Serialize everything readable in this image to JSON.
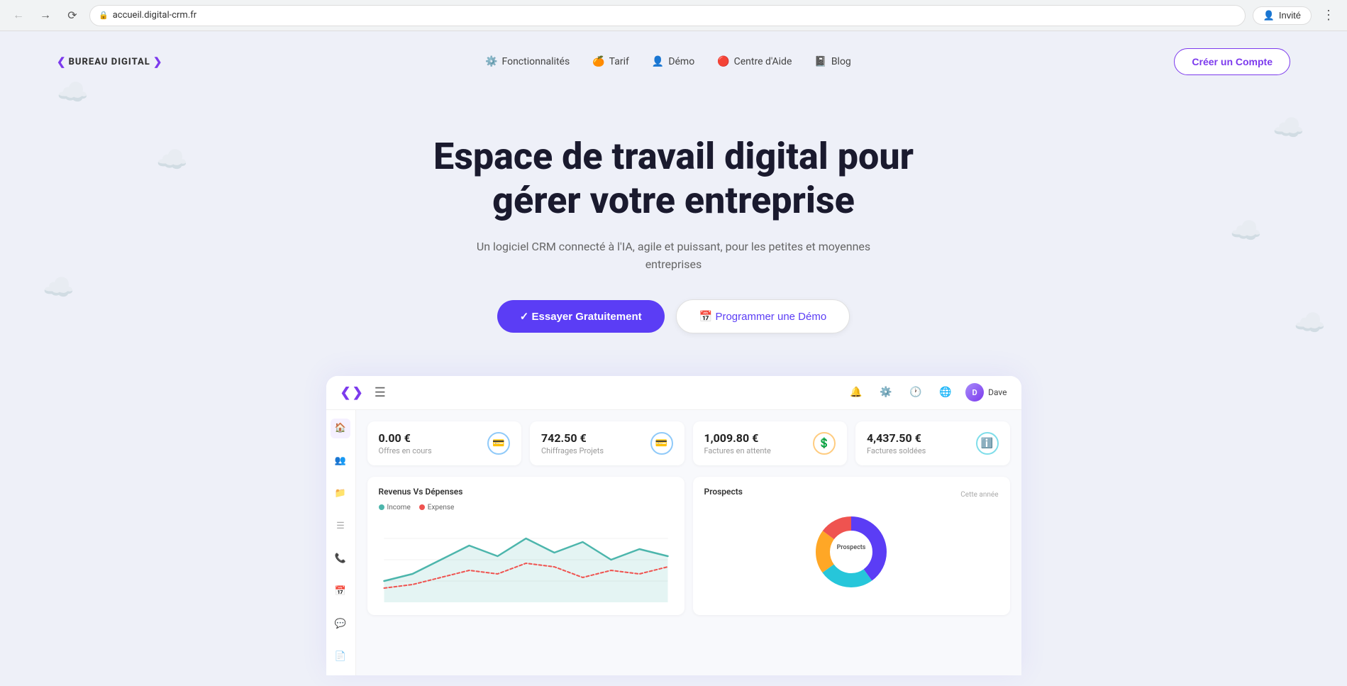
{
  "browser": {
    "url": "accueil.digital-crm.fr",
    "back_disabled": false,
    "forward_disabled": false,
    "invite_label": "Invité",
    "lock_icon": "🔒"
  },
  "nav": {
    "logo_left_chevron": "❮",
    "logo_text": "BUREAU DIGITAL",
    "logo_right_chevron": "❯",
    "links": [
      {
        "icon": "⚙️",
        "label": "Fonctionnalités"
      },
      {
        "icon": "🍊",
        "label": "Tarif"
      },
      {
        "icon": "👤",
        "label": "Démo"
      },
      {
        "icon": "🔴",
        "label": "Centre d'Aide"
      },
      {
        "icon": "📓",
        "label": "Blog"
      }
    ],
    "cta_label": "Créer un Compte"
  },
  "hero": {
    "title_line1": "Espace de travail digital pour",
    "title_line2": "gérer votre entreprise",
    "subtitle": "Un logiciel CRM connecté à l'IA, agile et puissant, pour les petites et moyennes entreprises",
    "btn_primary": "✓ Essayer Gratuitement",
    "btn_secondary": "📅 Programmer une Démo"
  },
  "dashboard": {
    "header": {
      "logo_left": "❮",
      "logo_right": "❯",
      "hamburger": "☰",
      "icons": [
        "🔔",
        "⚙️",
        "🕐",
        "🌐"
      ],
      "user_label": "Dave",
      "user_initials": "D"
    },
    "sidebar_icons": [
      {
        "name": "home",
        "symbol": "🏠",
        "active": true
      },
      {
        "name": "users",
        "symbol": "👥",
        "active": false
      },
      {
        "name": "folder",
        "symbol": "📁",
        "active": false
      },
      {
        "name": "list",
        "symbol": "☰",
        "active": false
      },
      {
        "name": "phone",
        "symbol": "📞",
        "active": false
      },
      {
        "name": "calendar",
        "symbol": "📅",
        "active": false
      },
      {
        "name": "message",
        "symbol": "💬",
        "active": false
      },
      {
        "name": "document",
        "symbol": "📄",
        "active": false
      }
    ],
    "stats": [
      {
        "value": "0.00 €",
        "label": "Offres en cours",
        "icon": "💳",
        "icon_class": "blue"
      },
      {
        "value": "742.50 €",
        "label": "Chiffrages Projets",
        "icon": "💳",
        "icon_class": "blue"
      },
      {
        "value": "1,009.80 €",
        "label": "Factures en attente",
        "icon": "💲",
        "icon_class": "orange"
      },
      {
        "value": "4,437.50 €",
        "label": "Factures soldées",
        "icon": "ℹ️",
        "icon_class": "info"
      }
    ],
    "revenue_chart": {
      "title": "Revenus Vs Dépenses",
      "legend": [
        {
          "color": "#4db6ac",
          "label": "Income"
        },
        {
          "color": "#ef5350",
          "label": "Expense"
        }
      ]
    },
    "prospects_chart": {
      "title": "Prospects",
      "period": "Cette année",
      "center_label": "Prospects",
      "segments": [
        {
          "color": "#5b3df5",
          "value": 40
        },
        {
          "color": "#26c6da",
          "value": 25
        },
        {
          "color": "#ffa726",
          "value": 20
        },
        {
          "color": "#ef5350",
          "value": 15
        }
      ]
    }
  }
}
